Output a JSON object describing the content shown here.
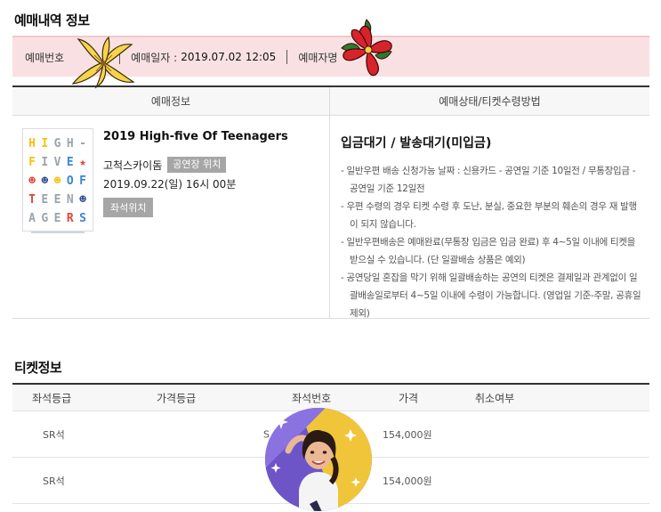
{
  "reservation_section": {
    "title": "예매내역 정보",
    "summary": {
      "reservation_no_label": "예매번호",
      "reservation_date_label": "예매일자 :",
      "reservation_date_value": "2019.07.02 12:05",
      "booker_label": "예매자명"
    },
    "table": {
      "col1_header": "예매정보",
      "col2_header": "예매상태/티켓수령방법"
    },
    "show": {
      "poster_rows": [
        [
          "H",
          "I",
          "G",
          "H",
          "-"
        ],
        [
          "F",
          "I",
          "V",
          "E",
          "★"
        ],
        [
          "☻",
          "☻",
          "☻",
          "O",
          "F"
        ],
        [
          "T",
          "E",
          "E",
          "N",
          "☻"
        ],
        [
          "A",
          "G",
          "E",
          "R",
          "S"
        ]
      ],
      "title": "2019 High-five Of Teenagers",
      "venue": "고척스카이돔",
      "venue_location_button": "공연장 위치",
      "datetime": "2019.09.22(일) 16시 00분",
      "seat_location_button": "좌석위치"
    },
    "status": {
      "title": "입금대기 / 발송대기(미입금)",
      "notes": [
        "- 일반우편 배송 신청가능 날짜 : 신용카드 - 공연일 기준 10일전 / 무통장입금 - 공연일 기준 12일전",
        "- 우편 수령의 경우 티켓 수령 후 도난, 분실, 중요한 부분의 훼손의 경우 재 발행이 되지 않습니다.",
        "- 일반우편배송은 예매완료(무통장 입금은 입금 완료) 후 4~5일 이내에 티켓을 받으실 수 있습니다. (단 일괄배송 상품은 예외)",
        "- 공연당일 혼잡을 막기 위해 일괄배송하는 공연의 티켓은 결제일과 관계없이 일괄배송일로부터 4~5일 이내에 수령이 가능합니다. (영업일 기준-주말, 공휴일 제외)"
      ]
    }
  },
  "ticket_section": {
    "title": "티켓정보",
    "headers": [
      "좌석등급",
      "가격등급",
      "좌석번호",
      "가격",
      "취소여부"
    ],
    "rows": [
      {
        "seat_grade": "SR석",
        "price_grade": "",
        "seat_no": "S",
        "price": "154,000원",
        "cancel": ""
      },
      {
        "seat_grade": "SR석",
        "price_grade": "",
        "seat_no": "",
        "price": "154,000원",
        "cancel": ""
      }
    ]
  },
  "colors": {
    "summary_bg": "#f9e1e3",
    "header_border": "#333333",
    "badge_bg": "#a6a6a6",
    "lily": "#f7d54a",
    "hibiscus": "#d8232a"
  },
  "stickers": [
    "lily-flower-sticker",
    "hibiscus-flower-sticker",
    "avatar-sticker"
  ]
}
